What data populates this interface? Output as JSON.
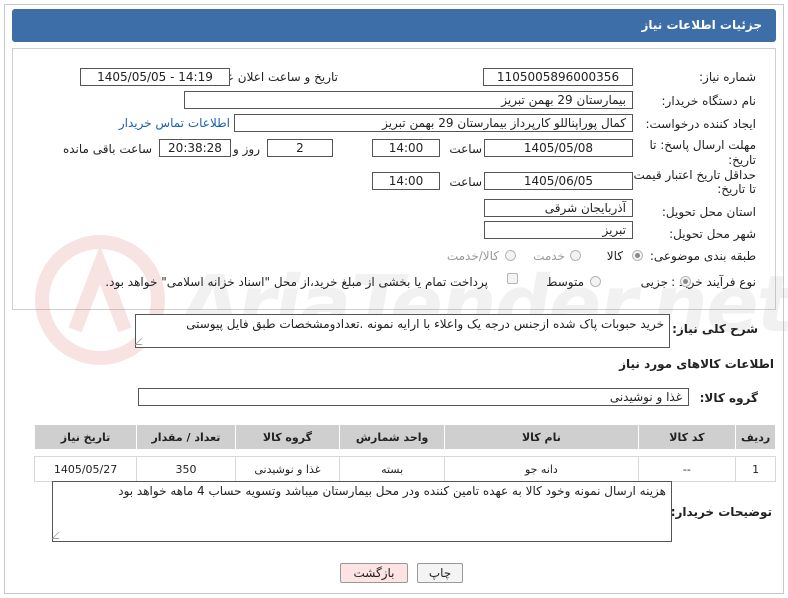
{
  "header": {
    "title": "جزئیات اطلاعات نیاز"
  },
  "form": {
    "need_number_label": "شماره نیاز:",
    "need_number": "1105005896000356",
    "announce_label": "تاریخ و ساعت اعلان عمومی:",
    "announce_value": "1405/05/05 - 14:19",
    "buyer_label": "نام دستگاه خریدار:",
    "buyer_value": "بیمارستان 29 بهمن تبریز",
    "creator_label": "ایجاد کننده درخواست:",
    "creator_value": "کمال پوراپناللو کارپرداز بیمارستان 29 بهمن تبریز",
    "contact_link": "اطلاعات تماس خریدار",
    "deadline_label_1": "مهلت ارسال پاسخ: تا",
    "deadline_label_2": "تاریخ:",
    "deadline_date": "1405/05/08",
    "time_label": "ساعت",
    "deadline_time": "14:00",
    "days_value": "2",
    "days_label": "روز و",
    "remaining_value": "20:38:28",
    "remaining_label": "ساعت باقی مانده",
    "validity_label_1": "حداقل تاریخ اعتبار قیمت:",
    "validity_label_2": "تا تاریخ:",
    "validity_date": "1405/06/05",
    "validity_time": "14:00",
    "province_label": "استان محل تحویل:",
    "province_value": "آذربایجان شرقی",
    "city_label": "شهر محل تحویل:",
    "city_value": "تبریز",
    "category_label": "طبقه بندی موضوعی:",
    "category_options": [
      "کالا",
      "خدمت",
      "کالا/خدمت"
    ],
    "category_selected": "کالا",
    "process_label": "نوع فرآیند خرید :",
    "process_options": [
      "جزیی",
      "متوسط"
    ],
    "process_selected": "جزیی",
    "payment_text": "پرداخت تمام یا بخشی از مبلغ خرید،از محل \"اسناد خزانه اسلامی\" خواهد بود."
  },
  "description": {
    "label": "شرح کلی نیاز:",
    "value": "خرید حبوبات پاک شده ازجنس درجه یک واعلاء با ارایه نمونه .تعدادومشخصات طبق فایل پیوستی"
  },
  "goods": {
    "section_title": "اطلاعات کالاهای مورد نیاز",
    "group_label": "گروه کالا:",
    "group_value": "غذا و نوشیدنی",
    "columns": [
      "ردیف",
      "کد کالا",
      "نام کالا",
      "واحد شمارش",
      "گروه کالا",
      "تعداد / مقدار",
      "تاریخ نیاز"
    ],
    "rows": [
      [
        "1",
        "--",
        "دانه جو",
        "بسته",
        "غذا و نوشیدنی",
        "350",
        "1405/05/27"
      ]
    ]
  },
  "buyer_notes": {
    "label": "توضیحات خریدار:",
    "value": "هزینه ارسال نمونه وخود کالا به عهده تامین کننده ودر محل بیمارستان میباشد وتسویه حساب 4 ماهه خواهد بود"
  },
  "buttons": {
    "print": "چاپ",
    "back": "بازگشت"
  },
  "watermark": "AriaTender.net",
  "colors": {
    "header": "#3d6ea8",
    "link": "#1a5fb4",
    "back_button_bg": "#fde3e3"
  }
}
